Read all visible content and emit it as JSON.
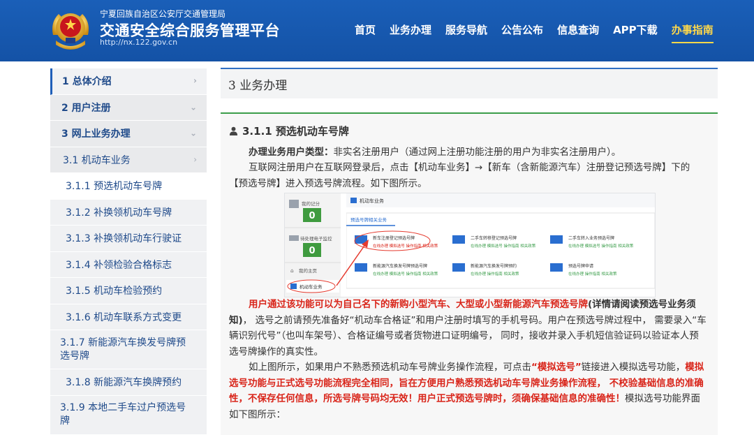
{
  "header": {
    "org": "宁夏回族自治区公安厅交通管理局",
    "platform": "交通安全综合服务管理平台",
    "url": "http://nx.122.gov.cn",
    "nav": [
      "首页",
      "业务办理",
      "服务导航",
      "公告公布",
      "信息查询",
      "APP下载",
      "办事指南"
    ],
    "active_nav": "办事指南",
    "colors": {
      "bar": "#1452a6",
      "active": "#ffd84a"
    }
  },
  "sidebar": {
    "items": [
      {
        "label": "1 总体介绍",
        "level": 1,
        "chev": "›"
      },
      {
        "label": "2 用户注册",
        "level": 1,
        "chev": "⌄"
      },
      {
        "label": "3 网上业务办理",
        "level": 1,
        "chev": "⌄"
      },
      {
        "label": "3.1 机动车业务",
        "level": 2,
        "chev": "›"
      },
      {
        "label": "3.1.1 预选机动车号牌",
        "level": 3
      },
      {
        "label": "3.1.2 补换领机动车号牌",
        "level": 3
      },
      {
        "label": "3.1.3 补换领机动车行驶证",
        "level": 3
      },
      {
        "label": "3.1.4 补领检验合格标志",
        "level": 3
      },
      {
        "label": "3.1.5 机动车检验预约",
        "level": 3
      },
      {
        "label": "3.1.6 机动车联系方式变更",
        "level": 3
      },
      {
        "label": "3.1.7 新能源汽车换发号牌预选号牌",
        "level": 3
      },
      {
        "label": "3.1.8 新能源汽车换牌预约",
        "level": 3
      },
      {
        "label": "3.1.9 本地二手车过户预选号牌",
        "level": 3
      }
    ]
  },
  "content": {
    "section_title": "3 业务办理",
    "sub_title": "3.1.1 预选机动车号牌",
    "p1_label": "办理业务用户类型：",
    "p1_text": "非实名注册用户（通过网上注册功能注册的用户为非实名注册用户）。",
    "p2": "互联网注册用户在互联网登录后，点击【机动车业务】→【新车（含新能源汽车）注册登记预选号牌】下的【预选号牌】进入预选号牌流程。如下图所示。",
    "p3_red": "用户通过该功能可以为自己名下的新购小型汽车、大型或小型新能源汽车预选号牌",
    "p3_bold": "(详情请阅读预选号业务须知)",
    "p3_rest": "， 选号之前请预先准备好“机动车合格证”和用户注册时填写的手机号码。用户在预选号牌过程中， 需要录入“车辆识别代号”（也叫车架号）、合格证编号或者货物进口证明编号， 同时，接收并录入手机短信验证码以验证本人预选号牌操作的真实性。",
    "p4_a": "如上图所示，如果用户不熟悉预选机动车号牌业务操作流程，可点击",
    "p4_link": "“模拟选号”",
    "p4_b": "链接进入模拟选号功能，",
    "p4_red": "模拟选号功能与正式选号功能流程完全相同，旨在方便用户熟悉预选机动车号牌业务操作流程， 不校验基础信息的准确性，不保存任何信息，所选号牌号码均无效！用户正式预选号牌时，须确保基础信息的准确性！",
    "p4_end": "模拟选号功能界面如下图所示："
  },
  "screenshot": {
    "side": {
      "my_score": "我的记分",
      "score": "0",
      "pending": "待处理电子监控",
      "pending_count": "0",
      "home": "我的主页",
      "vehicle": "机动车业务"
    },
    "main": {
      "title": "机动车业务",
      "tab": "预选号牌相关业务",
      "cards": [
        {
          "title": "新车注册登记预选号牌",
          "links": "在线办理 模拟选号 操作指南 相关政策"
        },
        {
          "title": "二手车转移登记预选号牌",
          "links": "在线办理 模拟选号 操作指南 相关政策"
        },
        {
          "title": "二手车转入业务预选号牌",
          "links": "在线办理 模拟选号 操作指南 相关政策"
        },
        {
          "title": "新能源汽车换发号牌预选号牌",
          "links": "在线办理 模拟选号 操作指南 相关政策"
        },
        {
          "title": "新能源汽车换发号牌预约",
          "links": "在线办理 操作指南 相关政策"
        },
        {
          "title": "预选号牌申请",
          "links": "在线办理 操作指南 相关政策"
        }
      ]
    }
  }
}
